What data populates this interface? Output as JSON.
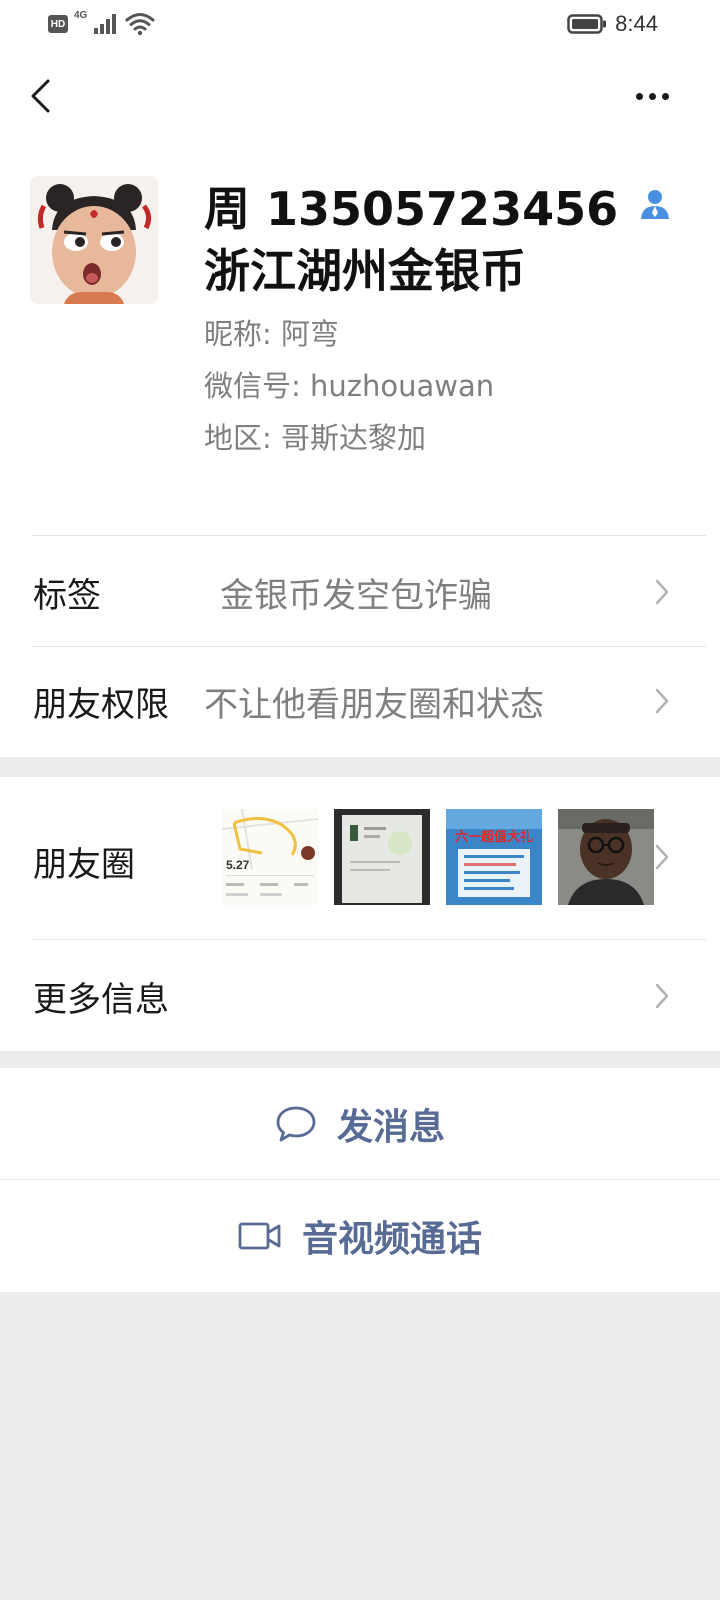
{
  "status_bar": {
    "hd_label": "HD",
    "network_label": "4G",
    "time": "8:44"
  },
  "nav": {
    "back_icon": "chevron-left-icon",
    "more_icon": "more-dots-icon"
  },
  "profile": {
    "name_line1": "周 13505723456",
    "name_line2": "浙江湖州金银币",
    "nickname": "昵称: 阿弯",
    "wechat_id": "微信号: huzhouawan",
    "region": "地区: 哥斯达黎加",
    "contact_icon": "contact-person-icon"
  },
  "rows": {
    "tags": {
      "title": "标签",
      "value": "金银币发空包诈骗"
    },
    "permissions": {
      "title": "朋友权限",
      "value": "不让他看朋友圈和状态"
    },
    "moments": {
      "title": "朋友圈",
      "thumb_texts": [
        "5.27",
        "六一超值大礼"
      ]
    },
    "more_info": {
      "title": "更多信息"
    }
  },
  "actions": {
    "send_message": "发消息",
    "call": "音视频通话"
  },
  "colors": {
    "link_blue": "#576b95",
    "contact_icon_blue": "#4a90e2",
    "background": "#ededed"
  }
}
